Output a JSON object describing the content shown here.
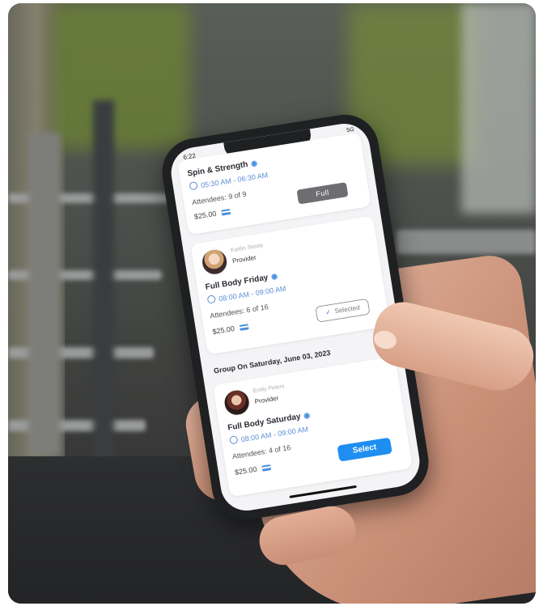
{
  "status": {
    "time": "6:22",
    "signal": "5G"
  },
  "classes": [
    {
      "title": "Spin & Strength",
      "time": "05:30 AM - 06:30 AM",
      "attendees": "Attendees: 9 of 9",
      "price": "$25.00",
      "button": "Full"
    },
    {
      "provider_name": "Kaitlin Steele",
      "provider_role": "Provider",
      "title": "Full Body Friday",
      "time": "08:00 AM - 09:00 AM",
      "attendees": "Attendees: 6 of 16",
      "price": "$25.00",
      "button": "Selected"
    },
    {
      "provider_name": "Emily Peters",
      "provider_role": "Provider",
      "title": "Full Body Saturday",
      "time": "08:00 AM - 09:00 AM",
      "attendees": "Attendees: 4 of 16",
      "price": "$25.00",
      "button": "Select"
    }
  ],
  "group_header": "Group On Saturday, June 03, 2023",
  "icons": {
    "location": "map-pin-icon",
    "clock": "clock-icon",
    "payment": "credit-card-icon",
    "check": "checkmark-icon"
  },
  "colors": {
    "accent": "#1f8ef1",
    "full_button": "#6e6e72",
    "link_blue": "#5d8fd6"
  }
}
